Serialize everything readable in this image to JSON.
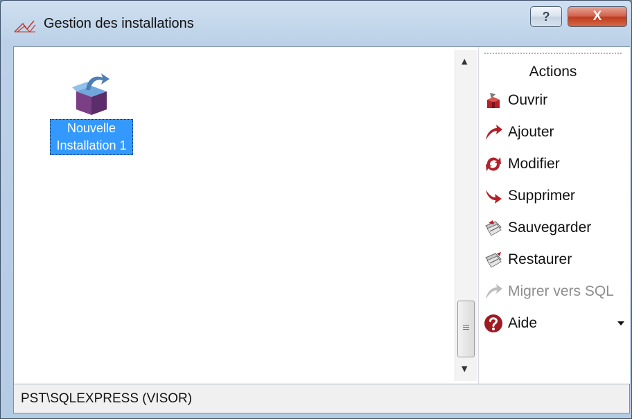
{
  "window": {
    "title": "Gestion des installations",
    "help_label": "?",
    "close_label": "X"
  },
  "main": {
    "items": [
      {
        "label": "Nouvelle Installation 1",
        "icon": "package-box-icon",
        "selected": true
      }
    ]
  },
  "actions": {
    "title": "Actions",
    "items": [
      {
        "label": "Ouvrir",
        "icon": "open-box-icon",
        "enabled": true
      },
      {
        "label": "Ajouter",
        "icon": "add-arrow-icon",
        "enabled": true
      },
      {
        "label": "Modifier",
        "icon": "modify-arrows-icon",
        "enabled": true
      },
      {
        "label": "Supprimer",
        "icon": "delete-arrow-icon",
        "enabled": true
      },
      {
        "label": "Sauvegarder",
        "icon": "backup-icon",
        "enabled": true
      },
      {
        "label": "Restaurer",
        "icon": "restore-icon",
        "enabled": true
      },
      {
        "label": "Migrer vers SQL",
        "icon": "migrate-arrow-icon",
        "enabled": false
      },
      {
        "label": "Aide",
        "icon": "help-icon",
        "enabled": true,
        "has_dropdown": true
      }
    ]
  },
  "status": {
    "text": "PST\\SQLEXPRESS (VISOR)"
  },
  "colors": {
    "selection": "#3399ff",
    "action_icon_red": "#b3202a",
    "disabled_text": "#8d8d8d",
    "close_button": "#c94a30"
  }
}
